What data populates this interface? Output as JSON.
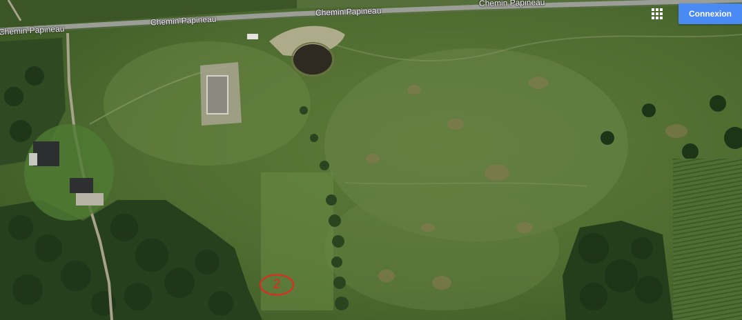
{
  "map": {
    "road_name": "Chemin Papineau",
    "road_labels": [
      "Chemin Papineau",
      "Chemin Papineau",
      "Chemin Papineau"
    ],
    "annotation_label": "2",
    "annotation_color": "#e8261f"
  },
  "header": {
    "apps_icon": "apps-grid-icon",
    "login_label": "Connexion",
    "login_color": "#4a8af4"
  }
}
